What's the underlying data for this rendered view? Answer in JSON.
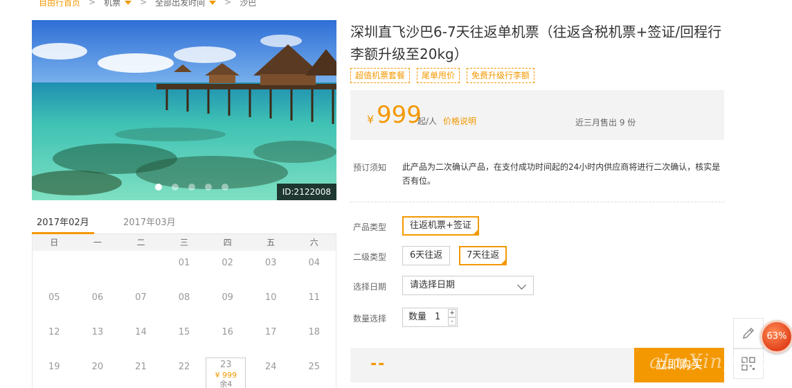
{
  "breadcrumb": {
    "home": "自由行首页",
    "flight": "机票",
    "departure": "全部出发时间",
    "destination": "沙巴"
  },
  "gallery": {
    "id_badge": "ID:2122008",
    "dot_count": 5,
    "active_dot": 1
  },
  "calendar": {
    "tabs": [
      "2017年02月",
      "2017年03月"
    ],
    "active_tab": 0,
    "weekdays": [
      "日",
      "一",
      "二",
      "三",
      "四",
      "五",
      "六"
    ],
    "rows": [
      [
        "",
        "",
        "",
        "01",
        "02",
        "03",
        "04"
      ],
      [
        "05",
        "06",
        "07",
        "08",
        "09",
        "10",
        "11"
      ],
      [
        "12",
        "13",
        "14",
        "15",
        "16",
        "17",
        "18"
      ],
      [
        "19",
        "20",
        "21",
        "22",
        "23",
        "24",
        "25"
      ]
    ],
    "priced_day": {
      "day": "23",
      "price": "¥ 999",
      "remaining": "余4"
    }
  },
  "product": {
    "title": "深圳直飞沙巴6-7天往返单机票（往返含税机票+签证/回程行李额升级至20kg）",
    "tags": [
      "超值机票套餐",
      "尾单甩价",
      "免费升级行李额"
    ],
    "currency": "¥",
    "price": "999",
    "price_unit": "起/人",
    "price_explain": "价格说明",
    "sold": "近三月售出 9 份",
    "notice_label": "预订须知",
    "notice_text": "此产品为二次确认产品，在支付成功时间起的24小时内供应商将进行二次确认，核实是否有位。"
  },
  "options": {
    "product_type_label": "产品类型",
    "product_types": [
      "往返机票+签证"
    ],
    "product_type_selected": 0,
    "sub_type_label": "二级类型",
    "sub_types": [
      "6天往返",
      "7天往返"
    ],
    "sub_type_selected": 1,
    "date_label": "选择日期",
    "date_value": "请选择日期",
    "qty_label": "数量选择",
    "qty_inner_label": "数量",
    "qty_value": "1",
    "qty_plus": "+",
    "qty_minus": "-"
  },
  "buy": {
    "total": "--",
    "button": "立即购买"
  },
  "floating": {
    "progress": "63%",
    "icons": [
      "pencil-icon",
      "qrcode-icon"
    ]
  },
  "watermark": "aLuXingo.net",
  "colors": {
    "accent": "#f39800",
    "panel": "#f3f3f3",
    "progress": "#e2431c"
  }
}
